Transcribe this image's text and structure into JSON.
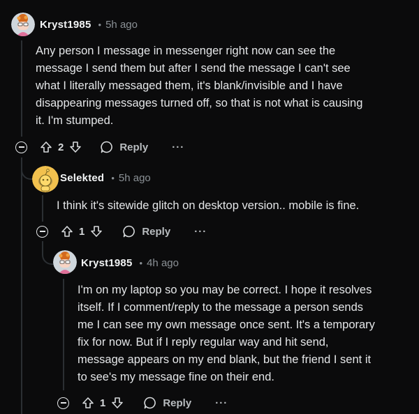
{
  "comments": [
    {
      "author": "Kryst1985",
      "time": "5h ago",
      "avatar_icon": "cartoon-avatar-icon",
      "body": [
        "Any person I message in messenger right now can see the",
        "message I send them but after I send the message I can't see",
        "what I literally messaged them, it's blank/invisible and I have",
        "disappearing messages turned off, so that is not what is causing",
        "it. I'm stumped."
      ],
      "score": "2",
      "reply_label": "Reply",
      "more_label": "···"
    },
    {
      "author": "Selekted",
      "time": "5h ago",
      "avatar_icon": "snoo-avatar-icon",
      "body": [
        "I think it's sitewide glitch on desktop version.. mobile is fine."
      ],
      "score": "1",
      "reply_label": "Reply",
      "more_label": "···"
    },
    {
      "author": "Kryst1985",
      "time": "4h ago",
      "avatar_icon": "cartoon-avatar-icon",
      "body": [
        "I'm on my laptop so you may be correct. I hope it resolves",
        "itself. If I comment/reply to the message a person sends",
        "me I can see my own message once sent. It's a temporary",
        "fix for now. But if I reply regular way and hit send,",
        "message appears on my end blank, but the friend I sent it",
        "to see's my message fine on their end."
      ],
      "score": "1",
      "reply_label": "Reply",
      "more_label": "···"
    }
  ],
  "separator": "•",
  "colors": {
    "background": "#0b0b0c",
    "thread_line": "#2b2f33",
    "text": "#e4e6e8",
    "muted": "#8b9196"
  }
}
